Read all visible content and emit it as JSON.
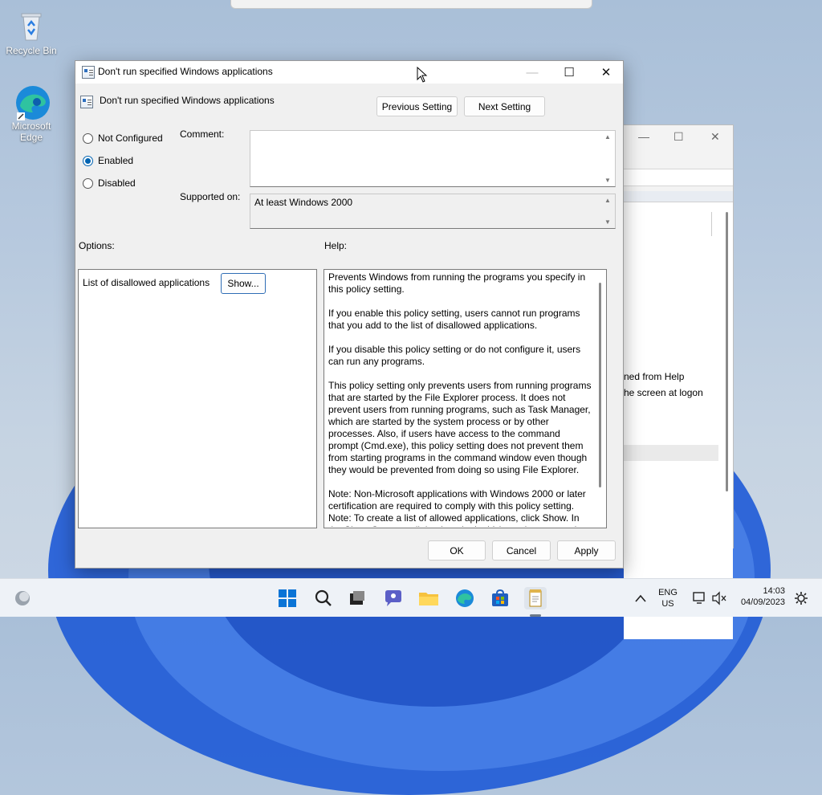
{
  "desktop": {
    "icons": [
      {
        "label": "Recycle Bin"
      },
      {
        "label": "Microsoft Edge"
      }
    ]
  },
  "background_window": {
    "controls": {
      "minimize": "—",
      "maximize": "☐",
      "close": "✕"
    },
    "visible_text": [
      "ned from Help",
      "he screen at logon"
    ]
  },
  "dialog": {
    "window_title": "Don't run specified Windows applications",
    "setting_name": "Don't run specified Windows applications",
    "previous_setting_label": "Previous Setting",
    "next_setting_label": "Next Setting",
    "options": [
      {
        "label": "Not Configured",
        "selected": false
      },
      {
        "label": "Enabled",
        "selected": true
      },
      {
        "label": "Disabled",
        "selected": false
      }
    ],
    "comment_label": "Comment:",
    "comment_value": "",
    "supported_on_label": "Supported on:",
    "supported_on_value": "At least Windows 2000",
    "options_label": "Options:",
    "help_label": "Help:",
    "option_item_label": "List of disallowed applications",
    "show_button_label": "Show...",
    "help_paragraphs": [
      "Prevents Windows from running the programs you specify in this policy setting.",
      "If you enable this policy setting, users cannot run programs that you add to the list of disallowed applications.",
      "If you disable this policy setting or do not configure it, users can run any programs.",
      "This policy setting only prevents users from running programs that are started by the File Explorer process. It does not prevent users from running programs, such as Task Manager, which are started by the system process or by other processes.  Also, if users have access to the command prompt (Cmd.exe), this policy setting does not prevent them from starting programs in the command window even though they would be prevented from doing so using File Explorer.",
      "Note: Non-Microsoft applications with Windows 2000 or later certification are required to comply with this policy setting. Note: To create a list of allowed applications, click Show.  In the Show Contents dialog box, in the Value column, type the"
    ],
    "ok_label": "OK",
    "cancel_label": "Cancel",
    "apply_label": "Apply"
  },
  "taskbar": {
    "apps": [
      "start-icon",
      "search-icon",
      "task-view-icon",
      "chat-icon",
      "file-explorer-icon",
      "edge-icon",
      "store-icon",
      "notepad-icon"
    ],
    "language_line1": "ENG",
    "language_line2": "US",
    "time": "14:03",
    "date": "04/09/2023"
  },
  "colors": {
    "accent": "#0063b1",
    "desktop_bloom": "#1e5ad6"
  }
}
